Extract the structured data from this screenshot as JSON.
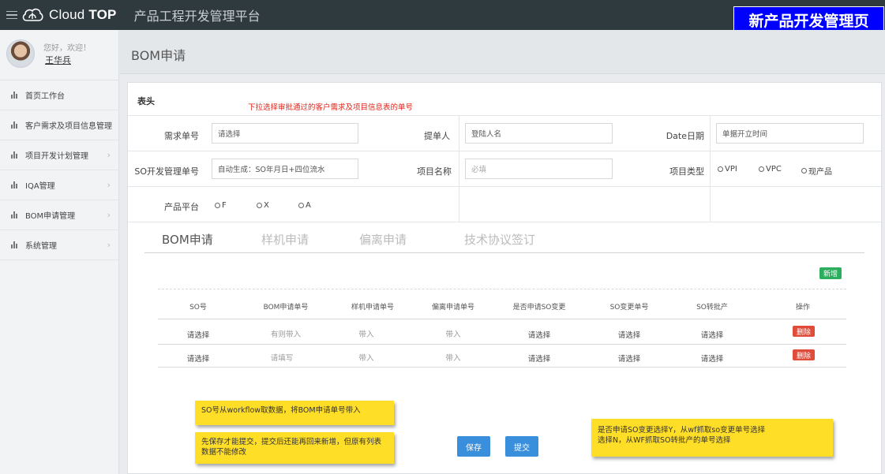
{
  "app": {
    "logo_text_light": "Cloud",
    "logo_text_bold": "TOP",
    "platform_title": "产品工程开发管理平台",
    "banner": "新产品开发管理页"
  },
  "user": {
    "greeting": "您好，欢迎！",
    "name": "王华兵"
  },
  "sidebar": {
    "items": [
      {
        "label": "首页工作台",
        "arrow": ""
      },
      {
        "label": "客户需求及项目信息管理",
        "arrow": "›"
      },
      {
        "label": "项目开发计划管理",
        "arrow": "›"
      },
      {
        "label": "IQA管理",
        "arrow": "›"
      },
      {
        "label": "BOM申请管理",
        "arrow": "›"
      },
      {
        "label": "系统管理",
        "arrow": "›"
      }
    ]
  },
  "page": {
    "title": "BOM申请"
  },
  "form": {
    "section_title": "表头",
    "red_note": "下拉选择审批通过的客户需求及项目信息表的单号",
    "req_no": {
      "label": "需求单号",
      "value": "请选择"
    },
    "submitter": {
      "label": "提单人",
      "value": "登陆人名"
    },
    "date": {
      "label": "Date日期",
      "value": "单据开立时间"
    },
    "so_no": {
      "label": "SO开发管理单号",
      "value": "自动生成：SO年月日+四位流水"
    },
    "project_name": {
      "label": "项目名称",
      "value": "必填"
    },
    "project_type": {
      "label": "项目类型",
      "options": [
        "VPI",
        "VPC",
        "现产品"
      ]
    },
    "platform": {
      "label": "产品平台",
      "options": [
        "F",
        "X",
        "A"
      ]
    }
  },
  "tabs": [
    "BOM申请",
    "样机申请",
    "偏离申请",
    "技术协议签订"
  ],
  "table": {
    "add_label": "新增",
    "headers": [
      "SO号",
      "BOM申请单号",
      "样机申请单号",
      "偏离申请单号",
      "是否申请SO变更",
      "SO变更单号",
      "SO转批产",
      "操作"
    ],
    "rows": [
      [
        "请选择",
        "有则带入",
        "带入",
        "带入",
        "请选择",
        "请选择",
        "请选择"
      ],
      [
        "请选择",
        "请填写",
        "带入",
        "带入",
        "请选择",
        "请选择",
        "请选择"
      ]
    ],
    "delete_label": "删除"
  },
  "notes": {
    "note1": "SO号从workflow取数据，将BOM申请单号带入",
    "note2_line1": "先保存才能提交，提交后还能再回来新增，但原有列表",
    "note2_line2": "数据不能修改",
    "note3_line1": "是否申请SO变更选择Y，从wf抓取so变更单号选择",
    "note3_line2": "选择N，从WF抓取SO转批产的单号选择"
  },
  "buttons": {
    "save": "保存",
    "submit": "提交"
  },
  "colors": {
    "topbar": "#2f3a3f",
    "banner": "#0000ff",
    "add": "#2cae5e",
    "delete": "#e04b3a",
    "primary": "#3a8fdc",
    "sticky": "#ffde28",
    "red_note": "#e0251b"
  }
}
